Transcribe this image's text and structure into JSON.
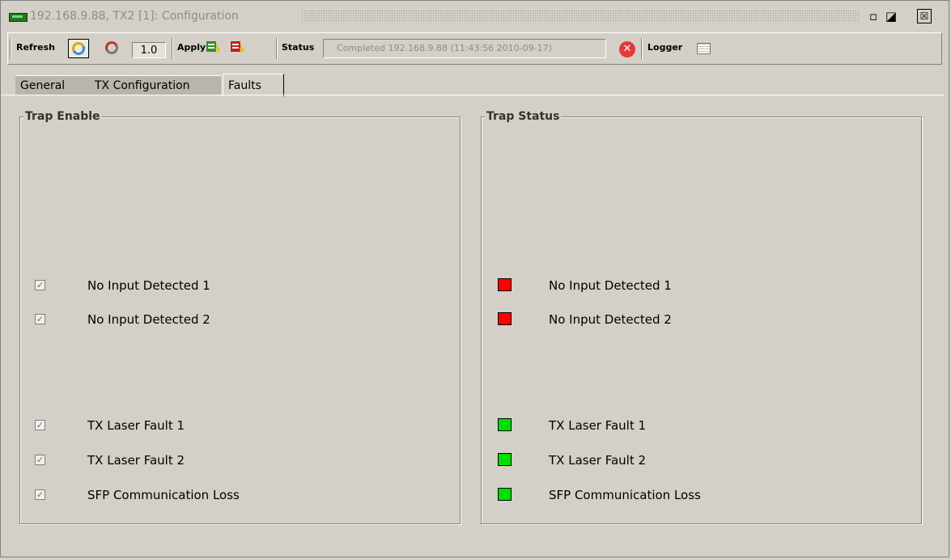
{
  "window": {
    "title": "192.168.9.88, TX2  [1]: Configuration",
    "controls": {
      "minimize": "▫",
      "maximize": "◪",
      "close": "☒"
    }
  },
  "toolbar": {
    "refresh_label": "Refresh",
    "refresh_rate": "1.0",
    "apply_label": "Apply",
    "status_label": "Status",
    "status_text": "Completed 192.168.9.88 (11:43:56  2010-09-17)",
    "logger_label": "Logger",
    "icons": [
      "refresh-icon",
      "stop-refresh-icon",
      "apply-green-icon",
      "apply-red-icon",
      "error-icon",
      "logger-icon"
    ]
  },
  "tabs": [
    {
      "label": "General"
    },
    {
      "label": "TX Configuration"
    },
    {
      "label": "Faults",
      "active": true
    }
  ],
  "trap_enable": {
    "title": "Trap Enable",
    "items": [
      {
        "label": "No Input Detected 1",
        "checked": true
      },
      {
        "label": "No Input Detected 2",
        "checked": true
      },
      {
        "label": "TX Laser Fault 1",
        "checked": true
      },
      {
        "label": "TX Laser Fault 2",
        "checked": true
      },
      {
        "label": "SFP Communication Loss",
        "checked": true
      }
    ]
  },
  "trap_status": {
    "title": "Trap Status",
    "items": [
      {
        "label": "No Input Detected 1",
        "status": "fault",
        "color": "#ff0000"
      },
      {
        "label": "No Input Detected 2",
        "status": "fault",
        "color": "#ff0000"
      },
      {
        "label": "TX Laser Fault 1",
        "status": "ok",
        "color": "#00e000"
      },
      {
        "label": "TX Laser Fault 2",
        "status": "ok",
        "color": "#00e000"
      },
      {
        "label": "SFP Communication Loss",
        "status": "ok",
        "color": "#00e000"
      }
    ]
  }
}
